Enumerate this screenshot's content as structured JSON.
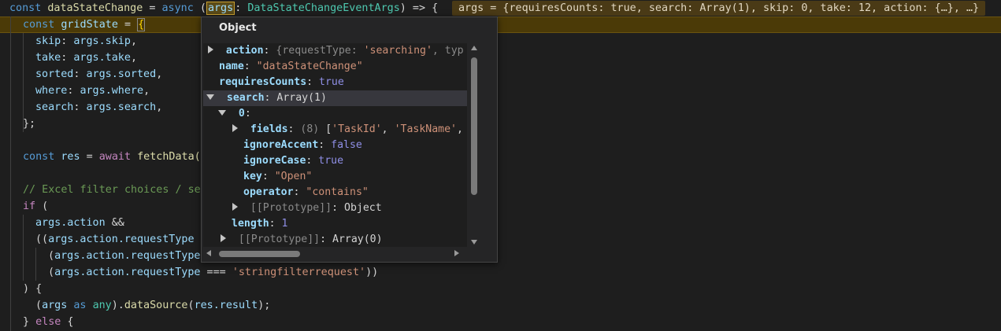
{
  "editor": {
    "inline_hint": "args = {requiresCounts: true, search: Array(1), skip: 0, take: 12, action: {…}, …}",
    "lines": {
      "l1": {
        "kw_const": "const",
        "name": "dataStateChange",
        "eq": " = ",
        "async": "async",
        "paren": " (",
        "args": "args",
        "colon": ": ",
        "type": "DataStateChangeEventArgs",
        "tail": ") => {"
      },
      "l2": {
        "kw_const": "const",
        "name": "gridState",
        "eq": " = ",
        "brace": "{"
      },
      "l3": {
        "key": "skip",
        "mid": ": ",
        "obj": "args",
        "prop": ".skip",
        "end": ","
      },
      "l4": {
        "key": "take",
        "mid": ": ",
        "obj": "args",
        "prop": ".take",
        "end": ","
      },
      "l5": {
        "key": "sorted",
        "mid": ": ",
        "obj": "args",
        "prop": ".sorted",
        "end": ","
      },
      "l6": {
        "key": "where",
        "mid": ": ",
        "obj": "args",
        "prop": ".where",
        "end": ","
      },
      "l7": {
        "key": "search",
        "mid": ": ",
        "obj": "args",
        "prop": ".search",
        "end": ","
      },
      "l8": {
        "text": "};"
      },
      "l10": {
        "kw_const": "const",
        "name": "res",
        "eq": " = ",
        "await": "await",
        "fn": "fetchData("
      },
      "l12": {
        "text": "// Excel filter choices / se"
      },
      "l13": {
        "kw_if": "if",
        "rest": " ("
      },
      "l14": {
        "obj": "args",
        "prop": ".action",
        "rest": " &&"
      },
      "l15": {
        "pre": "((",
        "obj": "args",
        "prop": ".action",
        "prop2": ".requestType"
      },
      "l16": {
        "pre": "(",
        "obj": "args",
        "prop": ".action",
        "prop2": ".requestType"
      },
      "l17": {
        "pre": "(",
        "obj": "args",
        "prop": ".action",
        "prop2": ".requestType",
        "op": " === ",
        "str": "'stringfilterrequest'",
        "end": "))"
      },
      "l18": {
        "text": ") {"
      },
      "l19": {
        "pre": "(",
        "obj": "args",
        "as": " as ",
        "any": "any",
        "close": ").",
        "fn": "dataSource",
        "open": "(",
        "res": "res",
        "prop": ".result",
        "end": ");"
      },
      "l20": {
        "pre": "} ",
        "else": "else",
        "end": " {"
      }
    }
  },
  "popup": {
    "title": "Object",
    "rows": [
      {
        "key": "action",
        "sep": ": ",
        "value": "{requestType: ",
        "value2": "'searching'",
        "value3": ", typ"
      },
      {
        "key": "name",
        "sep": ": ",
        "value": "\"dataStateChange\""
      },
      {
        "key": "requiresCounts",
        "sep": ": ",
        "value": "true"
      },
      {
        "key": "search",
        "sep": ": ",
        "value": "Array(1)"
      },
      {
        "key": "0",
        "sep": ":"
      },
      {
        "key": "fields",
        "sep": ": ",
        "count": "(8) ",
        "value": "[",
        "value2": "'TaskId'",
        "value3": ", ",
        "value4": "'TaskName'",
        "value5": ","
      },
      {
        "key": "ignoreAccent",
        "sep": ": ",
        "value": "false"
      },
      {
        "key": "ignoreCase",
        "sep": ": ",
        "value": "true"
      },
      {
        "key": "key",
        "sep": ": ",
        "value": "\"Open\""
      },
      {
        "key": "operator",
        "sep": ": ",
        "value": "\"contains\""
      },
      {
        "key": "[[Prototype]]",
        "sep": ": ",
        "value": "Object"
      },
      {
        "key": "length",
        "sep": ": ",
        "value": "1"
      },
      {
        "key": "[[Prototype]]",
        "sep": ": ",
        "value": "Array(0)"
      }
    ]
  }
}
